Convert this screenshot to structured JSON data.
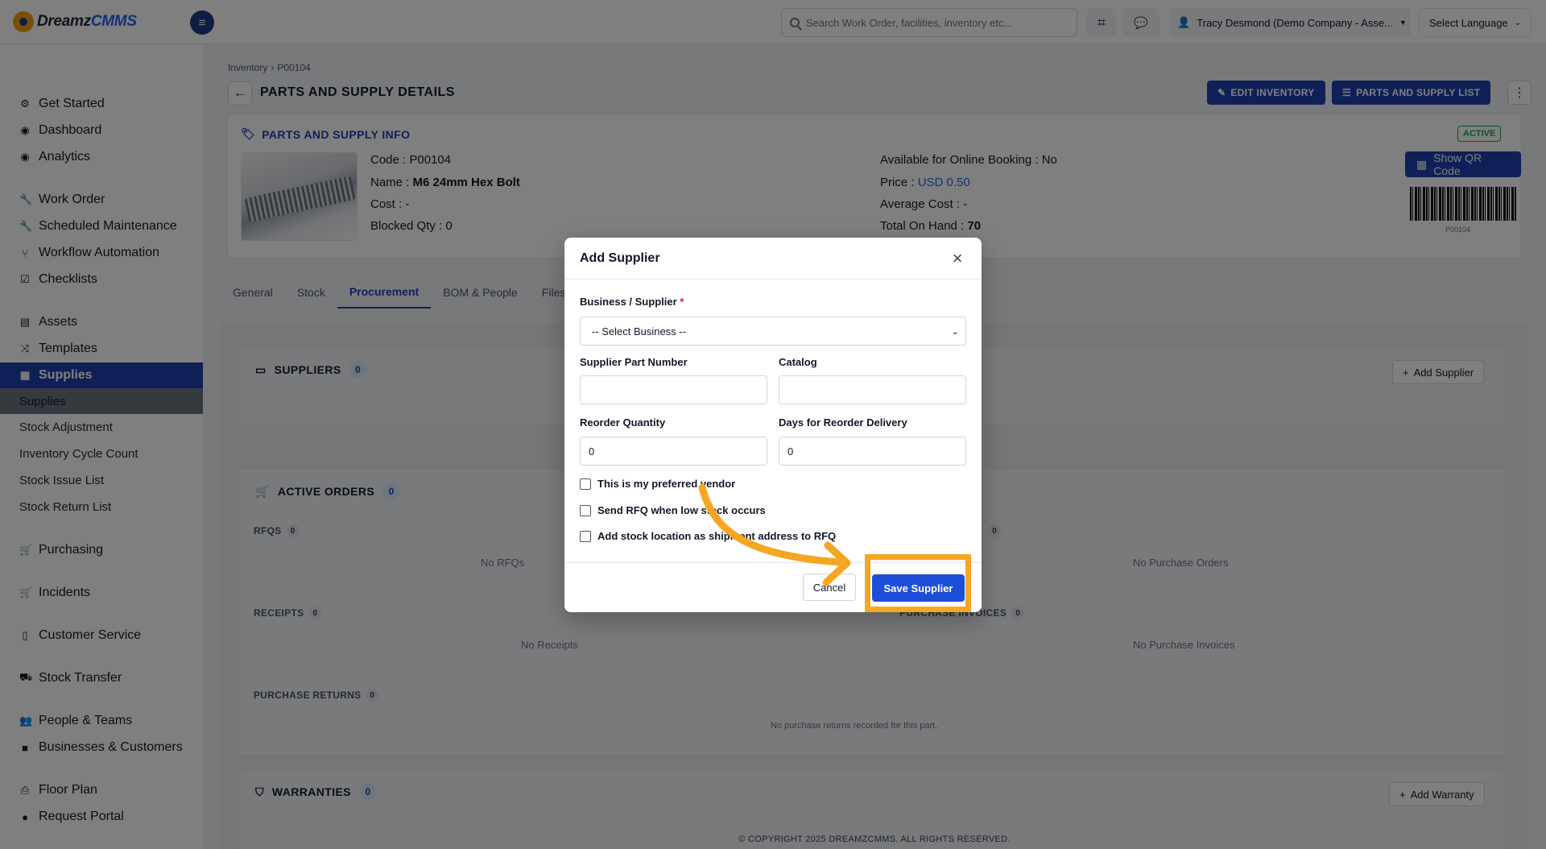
{
  "topbar": {
    "logo_dreamz": "Dreamz",
    "logo_cmms": "CMMS",
    "search_placeholder": "Search Work Order, facilities, inventory etc...",
    "user_label": "Tracy Desmond (Demo Company - Asse...",
    "language_label": "Select Language"
  },
  "sidebar": {
    "items": [
      {
        "label": "Get Started",
        "icon": "gear-icon"
      },
      {
        "label": "Dashboard",
        "icon": "dashboard-icon"
      },
      {
        "label": "Analytics",
        "icon": "analytics-icon"
      },
      {
        "label": "Work Order",
        "icon": "wrench-icon"
      },
      {
        "label": "Scheduled Maintenance",
        "icon": "wrench-icon"
      },
      {
        "label": "Workflow Automation",
        "icon": "workflow-icon"
      },
      {
        "label": "Checklists",
        "icon": "checklist-icon"
      },
      {
        "label": "Assets",
        "icon": "assets-icon"
      },
      {
        "label": "Templates",
        "icon": "shuffle-icon"
      },
      {
        "label": "Supplies",
        "icon": "supplies-icon"
      },
      {
        "label": "Purchasing",
        "icon": "cart-icon"
      },
      {
        "label": "Incidents",
        "icon": "cart-icon"
      },
      {
        "label": "Customer Service",
        "icon": "document-icon"
      },
      {
        "label": "Stock Transfer",
        "icon": "truck-icon"
      },
      {
        "label": "People & Teams",
        "icon": "people-icon"
      },
      {
        "label": "Businesses & Customers",
        "icon": "video-icon"
      },
      {
        "label": "Floor Plan",
        "icon": "printer-icon"
      },
      {
        "label": "Request Portal",
        "icon": "chat-icon"
      }
    ],
    "sub_items": [
      "Supplies",
      "Stock Adjustment",
      "Inventory Cycle Count",
      "Stock Issue List",
      "Stock Return List"
    ]
  },
  "page": {
    "breadcrumb_root": "Inventory",
    "breadcrumb_current": "P00104",
    "title": "PARTS AND SUPPLY DETAILS",
    "edit_button": "EDIT INVENTORY",
    "list_button": "PARTS AND SUPPLY LIST"
  },
  "info": {
    "section_title": "PARTS AND SUPPLY INFO",
    "status": "ACTIVE",
    "code_label": "Code : ",
    "code": "P00104",
    "name_label": "Name : ",
    "name": "M6 24mm Hex Bolt",
    "cost_label": "Cost : ",
    "cost": "-",
    "blocked_label": "Blocked Qty : ",
    "blocked": "0",
    "online_label": "Available for Online Booking : ",
    "online": "No",
    "price_label": "Price : ",
    "price": "USD 0.50",
    "avg_cost_label": "Average Cost : ",
    "avg_cost": "-",
    "on_hand_label": "Total On Hand : ",
    "on_hand": "70",
    "qr_button": "Show QR Code",
    "barcode_text": "P00104"
  },
  "tabs": [
    "General",
    "Stock",
    "Procurement",
    "BOM & People",
    "Files"
  ],
  "procurement": {
    "suppliers_title": "SUPPLIERS",
    "suppliers_count": "0",
    "add_supplier": "Add Supplier",
    "active_orders_title": "ACTIVE ORDERS",
    "active_orders_count": "0",
    "rfqs_label": "RFQS",
    "rfqs_count": "0",
    "rfqs_empty": "No RFQs",
    "po_count": "0",
    "po_empty": "No Purchase Orders",
    "receipts_label": "RECEIPTS",
    "receipts_count": "0",
    "receipts_empty": "No Receipts",
    "invoices_label": "PURCHASE INVOICES",
    "invoices_count": "0",
    "invoices_empty": "No Purchase Invoices",
    "returns_label": "PURCHASE RETURNS",
    "returns_count": "0",
    "returns_empty": "No purchase returns recorded for this part.",
    "warranties_title": "WARRANTIES",
    "warranties_count": "0",
    "add_warranty": "Add Warranty"
  },
  "footer": "© COPYRIGHT 2025 DREAMZCMMS. ALL RIGHTS RESERVED.",
  "modal": {
    "title": "Add Supplier",
    "business_label": "Business / Supplier",
    "business_required": "*",
    "business_select": "-- Select Business --",
    "part_number_label": "Supplier Part Number",
    "part_number_value": "",
    "catalog_label": "Catalog",
    "catalog_value": "",
    "reorder_qty_label": "Reorder Quantity",
    "reorder_qty_value": "0",
    "reorder_days_label": "Days for Reorder Delivery",
    "reorder_days_value": "0",
    "check_preferred": "This is my preferred vendor",
    "check_rfq": "Send RFQ when low stock occurs",
    "check_location": "Add stock location as shipment address to RFQ",
    "cancel": "Cancel",
    "save": "Save Supplier"
  },
  "colors": {
    "primary": "#1e40af",
    "annotation": "#f5a623",
    "active_badge": "#16a34a"
  }
}
